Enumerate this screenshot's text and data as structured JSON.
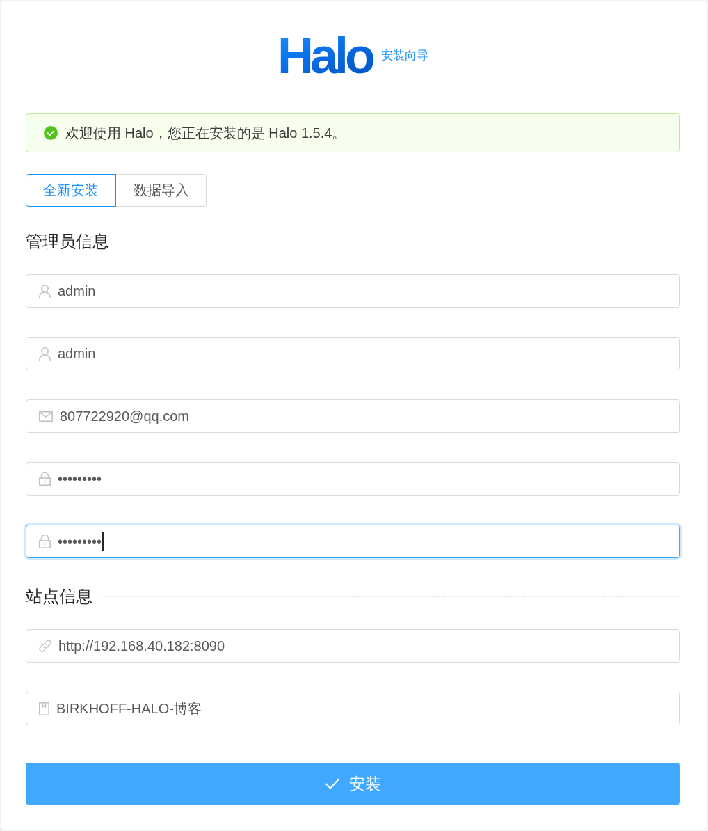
{
  "logo": {
    "text": "Halo",
    "subtitle": "安装向导"
  },
  "alert": {
    "kind": "success",
    "message": "欢迎使用 Halo，您正在安装的是 Halo 1.5.4。"
  },
  "tabs": [
    {
      "label": "全新安装",
      "selected": true
    },
    {
      "label": "数据导入",
      "selected": false
    }
  ],
  "sections": [
    {
      "title": "管理员信息",
      "fields": [
        {
          "kind": "user",
          "value": "admin",
          "focused": false
        },
        {
          "kind": "user",
          "value": "admin",
          "focused": false
        },
        {
          "kind": "email",
          "value": "807722920@qq.com",
          "focused": false
        },
        {
          "kind": "password",
          "value": "•••••••••",
          "focused": false
        },
        {
          "kind": "password",
          "value": "•••••••••",
          "focused": true
        }
      ]
    },
    {
      "title": "站点信息",
      "fields": [
        {
          "kind": "url",
          "value": "http://192.168.40.182:8090",
          "focused": false
        },
        {
          "kind": "title",
          "value": "BIRKHOFF-HALO-博客",
          "focused": false
        }
      ]
    }
  ],
  "submit_button": {
    "label": "安装"
  }
}
